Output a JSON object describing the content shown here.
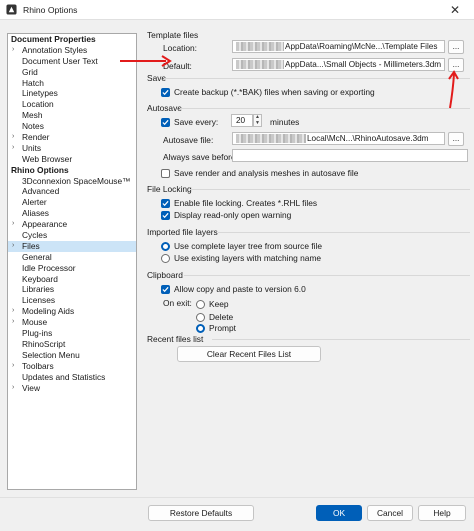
{
  "window": {
    "title": "Rhino Options",
    "close_glyph": "✕"
  },
  "tree": {
    "items": [
      {
        "label": "Document Properties",
        "header": true
      },
      {
        "label": "Annotation Styles",
        "expander": true
      },
      {
        "label": "Document User Text"
      },
      {
        "label": "Grid"
      },
      {
        "label": "Hatch"
      },
      {
        "label": "Linetypes"
      },
      {
        "label": "Location"
      },
      {
        "label": "Mesh"
      },
      {
        "label": "Notes"
      },
      {
        "label": "Render",
        "expander": true
      },
      {
        "label": "Units",
        "expander": true
      },
      {
        "label": "Web Browser"
      },
      {
        "label": "Rhino Options",
        "header": true
      },
      {
        "label": "3Dconnexion SpaceMouse™"
      },
      {
        "label": "Advanced"
      },
      {
        "label": "Alerter"
      },
      {
        "label": "Aliases"
      },
      {
        "label": "Appearance",
        "expander": true
      },
      {
        "label": "Cycles"
      },
      {
        "label": "Files",
        "expander": true,
        "selected": true
      },
      {
        "label": "General"
      },
      {
        "label": "Idle Processor"
      },
      {
        "label": "Keyboard"
      },
      {
        "label": "Libraries"
      },
      {
        "label": "Licenses"
      },
      {
        "label": "Modeling Aids",
        "expander": true
      },
      {
        "label": "Mouse",
        "expander": true
      },
      {
        "label": "Plug-ins"
      },
      {
        "label": "RhinoScript"
      },
      {
        "label": "Selection Menu"
      },
      {
        "label": "Toolbars",
        "expander": true
      },
      {
        "label": "Updates and Statistics"
      },
      {
        "label": "View",
        "expander": true
      }
    ]
  },
  "template_files": {
    "heading": "Template files",
    "location_label": "Location:",
    "location_value": "AppData\\Roaming\\McNe...\\Template Files",
    "default_label": "Default:",
    "default_value": "AppData...\\Small Objects - Millimeters.3dm",
    "browse_label": "..."
  },
  "save": {
    "heading": "Save",
    "create_backup": "Create backup (*.*BAK) files when saving or exporting"
  },
  "autosave": {
    "heading": "Autosave",
    "save_every": "Save every:",
    "minutes_value": "20",
    "minutes_label": "minutes",
    "file_label": "Autosave file:",
    "file_value": "Local\\McN...\\RhinoAutosave.3dm",
    "always_label": "Always save before:",
    "always_value": "",
    "render_meshes": "Save render and analysis meshes in autosave file",
    "browse_label": "..."
  },
  "file_locking": {
    "heading": "File Locking",
    "enable": "Enable file locking. Creates *.RHL files",
    "readonly": "Display read-only open warning"
  },
  "imported_layers": {
    "heading": "Imported file layers",
    "option_source": "Use complete layer tree from source file",
    "option_existing": "Use existing layers with matching name"
  },
  "clipboard": {
    "heading": "Clipboard",
    "allow_copy": "Allow copy and paste to version 6.0",
    "on_exit": "On exit:",
    "keep": "Keep",
    "delete": "Delete",
    "prompt": "Prompt"
  },
  "recent": {
    "heading": "Recent files list",
    "clear_button": "Clear Recent Files List"
  },
  "footer": {
    "restore": "Restore Defaults",
    "ok": "OK",
    "cancel": "Cancel",
    "help": "Help"
  },
  "colors": {
    "accent": "#005fb8",
    "annotation_arrow": "#e21b1b",
    "selection": "#cce4f7"
  }
}
